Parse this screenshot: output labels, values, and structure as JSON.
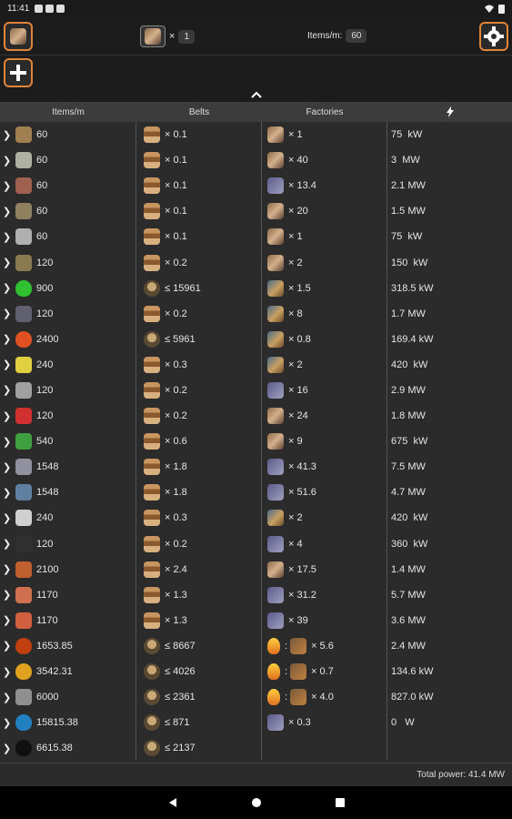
{
  "status": {
    "time": "11:41"
  },
  "toolbar": {
    "multiplier": "×",
    "count": "1",
    "rate_label": "Items/m:",
    "rate_value": "60"
  },
  "header": {
    "items": "Items/m",
    "belts": "Belts",
    "factories": "Factories",
    "power_icon": "lightning-icon"
  },
  "rows": [
    {
      "item": "radar",
      "items": "60",
      "belts": "× 0.1",
      "fac": "asm",
      "factories": "× 1",
      "power": "75  kW"
    },
    {
      "item": "lamp",
      "items": "60",
      "belts": "× 0.1",
      "fac": "asm",
      "factories": "× 40",
      "power": "3  MW"
    },
    {
      "item": "battery",
      "items": "60",
      "belts": "× 0.1",
      "fac": "oil",
      "factories": "× 13.4",
      "power": "2.1 MW"
    },
    {
      "item": "belt",
      "items": "60",
      "belts": "× 0.1",
      "fac": "asm",
      "factories": "× 20",
      "power": "1.5 MW"
    },
    {
      "item": "gear",
      "items": "60",
      "belts": "× 0.1",
      "fac": "asm",
      "factories": "× 1",
      "power": "75  kW"
    },
    {
      "item": "pump",
      "items": "120",
      "belts": "× 0.2",
      "fac": "asm",
      "factories": "× 2",
      "power": "150  kW"
    },
    {
      "item": "green",
      "items": "900",
      "belts": "≤ 15961",
      "pipe": true,
      "fac": "chem",
      "factories": "× 1.5",
      "power": "318.5 kW"
    },
    {
      "item": "steel",
      "items": "120",
      "belts": "× 0.2",
      "fac": "chem",
      "factories": "× 8",
      "power": "1.7 MW"
    },
    {
      "item": "orange",
      "items": "2400",
      "belts": "≤ 5961",
      "pipe": true,
      "fac": "chem",
      "factories": "× 0.8",
      "power": "169.4 kW"
    },
    {
      "item": "sulfur",
      "items": "240",
      "belts": "× 0.3",
      "fac": "chem",
      "factories": "× 2",
      "power": "420  kW"
    },
    {
      "item": "rod",
      "items": "120",
      "belts": "× 0.2",
      "fac": "oil",
      "factories": "× 16",
      "power": "2.9 MW"
    },
    {
      "item": "redcircuit",
      "items": "120",
      "belts": "× 0.2",
      "fac": "asm",
      "factories": "× 24",
      "power": "1.8 MW"
    },
    {
      "item": "greencircuit",
      "items": "540",
      "belts": "× 0.6",
      "fac": "asm",
      "factories": "× 9",
      "power": "675  kW"
    },
    {
      "item": "plate",
      "items": "1548",
      "belts": "× 1.8",
      "fac": "oil",
      "factories": "× 41.3",
      "power": "7.5 MW"
    },
    {
      "item": "wire",
      "items": "1548",
      "belts": "× 1.8",
      "fac": "oil",
      "factories": "× 51.6",
      "power": "4.7 MW"
    },
    {
      "item": "whiteplate",
      "items": "240",
      "belts": "× 0.3",
      "fac": "chem",
      "factories": "× 2",
      "power": "420  kW"
    },
    {
      "item": "coal",
      "items": "120",
      "belts": "× 0.2",
      "fac": "oil",
      "factories": "× 4",
      "power": "360  kW"
    },
    {
      "item": "copper",
      "items": "2100",
      "belts": "× 2.4",
      "fac": "asm",
      "factories": "× 17.5",
      "power": "1.4 MW"
    },
    {
      "item": "copperplate",
      "items": "1170",
      "belts": "× 1.3",
      "fac": "oil",
      "factories": "× 31.2",
      "power": "5.7 MW"
    },
    {
      "item": "cable",
      "items": "1170",
      "belts": "× 1.3",
      "fac": "oil",
      "factories": "× 39",
      "power": "3.6 MW"
    },
    {
      "item": "heavyoil",
      "items": "1653.85",
      "belts": "≤ 8667",
      "pipe": true,
      "fac": "refin",
      "factories": "× 5.6",
      "power": "2.4 MW",
      "multi": true
    },
    {
      "item": "lightoil",
      "items": "3542.31",
      "belts": "≤ 4026",
      "pipe": true,
      "fac": "refin",
      "factories": "× 0.7",
      "power": "134.6 kW",
      "multi": true
    },
    {
      "item": "gas",
      "items": "6000",
      "belts": "≤ 2361",
      "pipe": true,
      "fac": "refin",
      "factories": "× 4.0",
      "power": "827.0 kW",
      "multi": true
    },
    {
      "item": "water",
      "items": "15815.38",
      "belts": "≤ 871",
      "pipe": true,
      "fac": "oil",
      "factories": "× 0.3",
      "power": "0   W"
    },
    {
      "item": "crude",
      "items": "6615.38",
      "belts": "≤ 2137",
      "pipe": true,
      "fac": "",
      "factories": "",
      "power": ""
    }
  ],
  "footer": {
    "total": "Total power: 41.4 MW"
  },
  "colors": {
    "accent": "#e0843a"
  }
}
